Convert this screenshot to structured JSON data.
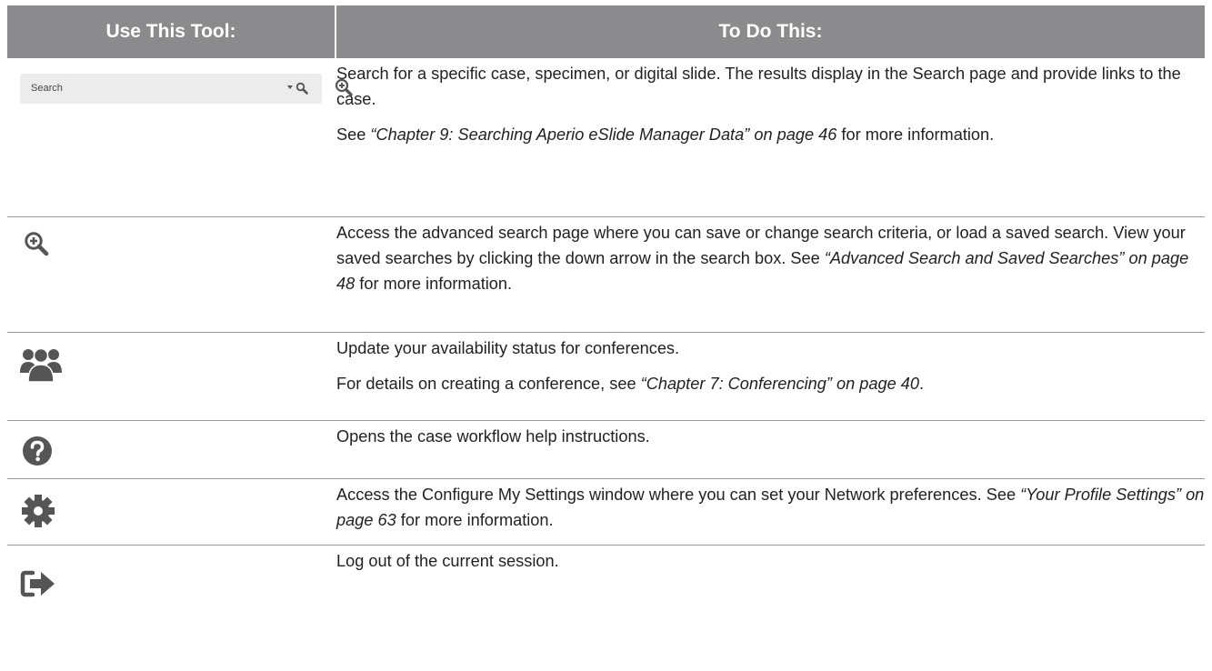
{
  "header": {
    "col1": "Use This Tool:",
    "col2": "To Do This:"
  },
  "rows": [
    {
      "icon": "search-box",
      "search_placeholder": "Search",
      "p1": "Search for a specific case, specimen, or digital slide. The results display in the Search page and provide links to the case.",
      "p2_pre": "See ",
      "p2_ref": "“Chapter 9: Searching Aperio eSlide Manager Data” on page 46",
      "p2_post": " for more information."
    },
    {
      "icon": "advanced-search-icon",
      "p1_pre": "Access the advanced search page where you can save or change search criteria, or load a saved search. View your saved searches by clicking the down arrow in the search box. See ",
      "p1_ref": "“Advanced Search and Saved Searches” on page 48",
      "p1_post": " for more information."
    },
    {
      "icon": "users-icon",
      "p1": "Update your availability status for conferences.",
      "p2_pre": "For details on creating a conference, see ",
      "p2_ref": "“Chapter 7: Conferencing” on page 40",
      "p2_post": "."
    },
    {
      "icon": "help-icon",
      "p1": "Opens the case workflow help instructions."
    },
    {
      "icon": "gear-icon",
      "p1_pre": "Access the Configure My Settings window where you can set your Network preferences. See ",
      "p1_ref": "“Your Profile Settings” on page 63",
      "p1_post": " for more information."
    },
    {
      "icon": "logout-icon",
      "p1": "Log out of the current session."
    }
  ],
  "colors": {
    "header_bg": "#8b8b8d",
    "icon": "#555555",
    "rule": "#9a9a9a"
  }
}
